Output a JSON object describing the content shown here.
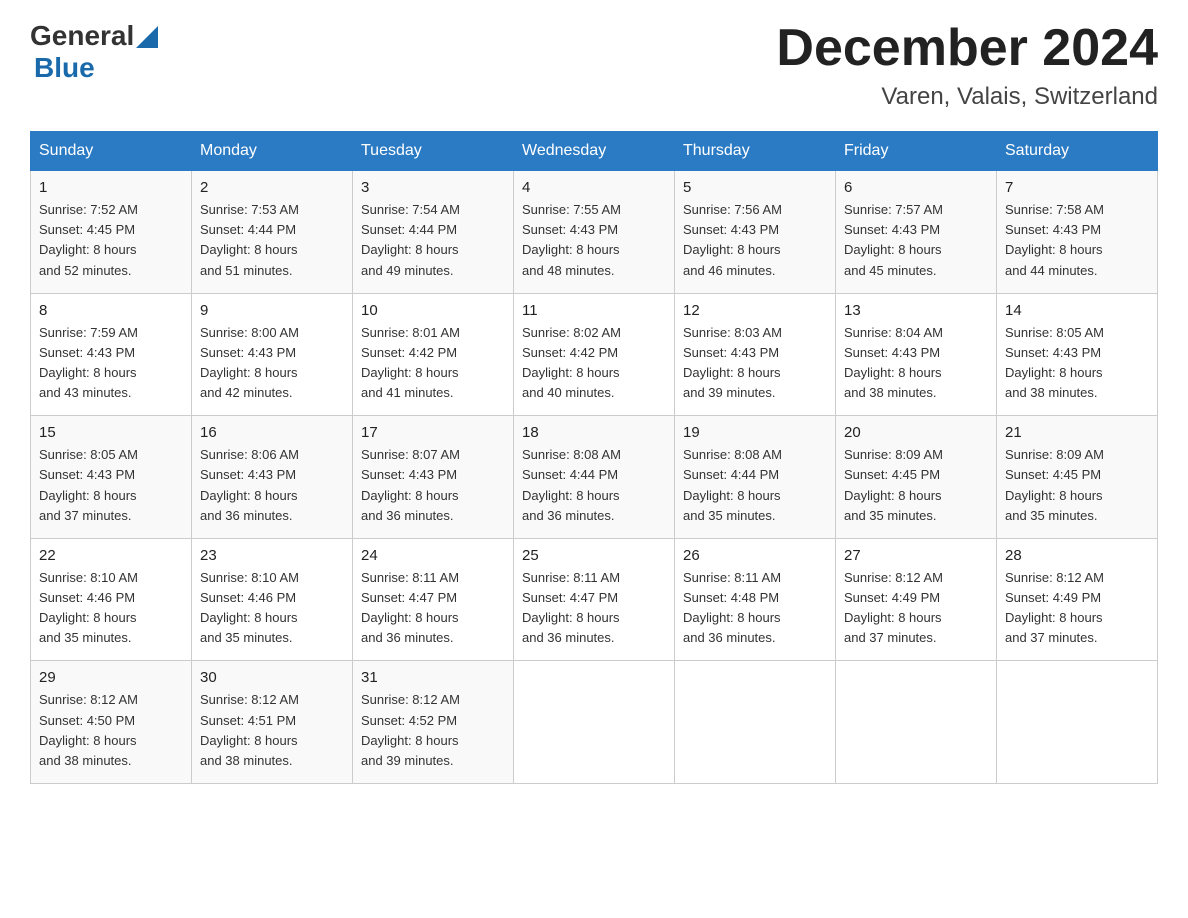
{
  "header": {
    "logo_general": "General",
    "logo_blue": "Blue",
    "month_title": "December 2024",
    "location": "Varen, Valais, Switzerland"
  },
  "weekdays": [
    "Sunday",
    "Monday",
    "Tuesday",
    "Wednesday",
    "Thursday",
    "Friday",
    "Saturday"
  ],
  "weeks": [
    [
      {
        "day": "1",
        "sunrise": "7:52 AM",
        "sunset": "4:45 PM",
        "daylight": "8 hours and 52 minutes."
      },
      {
        "day": "2",
        "sunrise": "7:53 AM",
        "sunset": "4:44 PM",
        "daylight": "8 hours and 51 minutes."
      },
      {
        "day": "3",
        "sunrise": "7:54 AM",
        "sunset": "4:44 PM",
        "daylight": "8 hours and 49 minutes."
      },
      {
        "day": "4",
        "sunrise": "7:55 AM",
        "sunset": "4:43 PM",
        "daylight": "8 hours and 48 minutes."
      },
      {
        "day": "5",
        "sunrise": "7:56 AM",
        "sunset": "4:43 PM",
        "daylight": "8 hours and 46 minutes."
      },
      {
        "day": "6",
        "sunrise": "7:57 AM",
        "sunset": "4:43 PM",
        "daylight": "8 hours and 45 minutes."
      },
      {
        "day": "7",
        "sunrise": "7:58 AM",
        "sunset": "4:43 PM",
        "daylight": "8 hours and 44 minutes."
      }
    ],
    [
      {
        "day": "8",
        "sunrise": "7:59 AM",
        "sunset": "4:43 PM",
        "daylight": "8 hours and 43 minutes."
      },
      {
        "day": "9",
        "sunrise": "8:00 AM",
        "sunset": "4:43 PM",
        "daylight": "8 hours and 42 minutes."
      },
      {
        "day": "10",
        "sunrise": "8:01 AM",
        "sunset": "4:42 PM",
        "daylight": "8 hours and 41 minutes."
      },
      {
        "day": "11",
        "sunrise": "8:02 AM",
        "sunset": "4:42 PM",
        "daylight": "8 hours and 40 minutes."
      },
      {
        "day": "12",
        "sunrise": "8:03 AM",
        "sunset": "4:43 PM",
        "daylight": "8 hours and 39 minutes."
      },
      {
        "day": "13",
        "sunrise": "8:04 AM",
        "sunset": "4:43 PM",
        "daylight": "8 hours and 38 minutes."
      },
      {
        "day": "14",
        "sunrise": "8:05 AM",
        "sunset": "4:43 PM",
        "daylight": "8 hours and 38 minutes."
      }
    ],
    [
      {
        "day": "15",
        "sunrise": "8:05 AM",
        "sunset": "4:43 PM",
        "daylight": "8 hours and 37 minutes."
      },
      {
        "day": "16",
        "sunrise": "8:06 AM",
        "sunset": "4:43 PM",
        "daylight": "8 hours and 36 minutes."
      },
      {
        "day": "17",
        "sunrise": "8:07 AM",
        "sunset": "4:43 PM",
        "daylight": "8 hours and 36 minutes."
      },
      {
        "day": "18",
        "sunrise": "8:08 AM",
        "sunset": "4:44 PM",
        "daylight": "8 hours and 36 minutes."
      },
      {
        "day": "19",
        "sunrise": "8:08 AM",
        "sunset": "4:44 PM",
        "daylight": "8 hours and 35 minutes."
      },
      {
        "day": "20",
        "sunrise": "8:09 AM",
        "sunset": "4:45 PM",
        "daylight": "8 hours and 35 minutes."
      },
      {
        "day": "21",
        "sunrise": "8:09 AM",
        "sunset": "4:45 PM",
        "daylight": "8 hours and 35 minutes."
      }
    ],
    [
      {
        "day": "22",
        "sunrise": "8:10 AM",
        "sunset": "4:46 PM",
        "daylight": "8 hours and 35 minutes."
      },
      {
        "day": "23",
        "sunrise": "8:10 AM",
        "sunset": "4:46 PM",
        "daylight": "8 hours and 35 minutes."
      },
      {
        "day": "24",
        "sunrise": "8:11 AM",
        "sunset": "4:47 PM",
        "daylight": "8 hours and 36 minutes."
      },
      {
        "day": "25",
        "sunrise": "8:11 AM",
        "sunset": "4:47 PM",
        "daylight": "8 hours and 36 minutes."
      },
      {
        "day": "26",
        "sunrise": "8:11 AM",
        "sunset": "4:48 PM",
        "daylight": "8 hours and 36 minutes."
      },
      {
        "day": "27",
        "sunrise": "8:12 AM",
        "sunset": "4:49 PM",
        "daylight": "8 hours and 37 minutes."
      },
      {
        "day": "28",
        "sunrise": "8:12 AM",
        "sunset": "4:49 PM",
        "daylight": "8 hours and 37 minutes."
      }
    ],
    [
      {
        "day": "29",
        "sunrise": "8:12 AM",
        "sunset": "4:50 PM",
        "daylight": "8 hours and 38 minutes."
      },
      {
        "day": "30",
        "sunrise": "8:12 AM",
        "sunset": "4:51 PM",
        "daylight": "8 hours and 38 minutes."
      },
      {
        "day": "31",
        "sunrise": "8:12 AM",
        "sunset": "4:52 PM",
        "daylight": "8 hours and 39 minutes."
      },
      null,
      null,
      null,
      null
    ]
  ]
}
